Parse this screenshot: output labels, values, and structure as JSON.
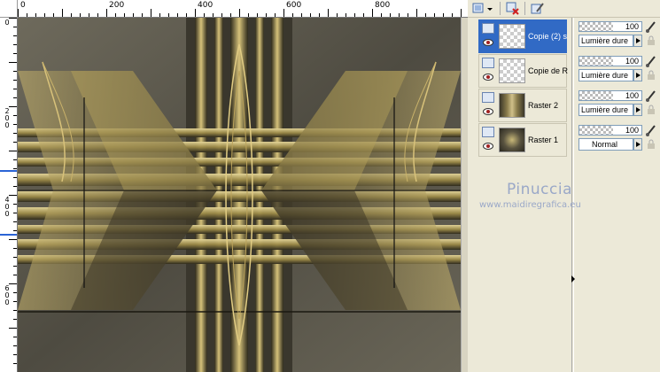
{
  "ruler": {
    "h_labels": [
      "0",
      "200",
      "400",
      "600",
      "800"
    ],
    "v_labels": [
      "0",
      "200",
      "400",
      "600"
    ]
  },
  "layers": [
    {
      "name": "Copie (2) s",
      "selected": true,
      "thumb": "transparent"
    },
    {
      "name": "Copie de R",
      "selected": false,
      "thumb": "transparent"
    },
    {
      "name": "Raster 2",
      "selected": false,
      "thumb": "pattern"
    },
    {
      "name": "Raster 1",
      "selected": false,
      "thumb": "pattern"
    }
  ],
  "properties": [
    {
      "opacity": "100",
      "blend": "Lumière dure"
    },
    {
      "opacity": "100",
      "blend": "Lumière dure"
    },
    {
      "opacity": "100",
      "blend": "Lumière dure"
    },
    {
      "opacity": "100",
      "blend": "Normal"
    }
  ],
  "watermark": {
    "name": "Pinuccia",
    "url": "www.maidiregrafica.eu"
  },
  "icons": {
    "toolbar": [
      "new-layer-icon",
      "dropdown-arrow-icon",
      "delete-layer-icon",
      "edit-layer-icon"
    ],
    "layer": [
      "layer-type-icon",
      "eye-icon"
    ],
    "property": [
      "brush-icon",
      "lock-icon"
    ]
  },
  "colors": {
    "selection": "#316ac5",
    "watermark": "#9aa8c8",
    "panel": "#ece9d8"
  }
}
